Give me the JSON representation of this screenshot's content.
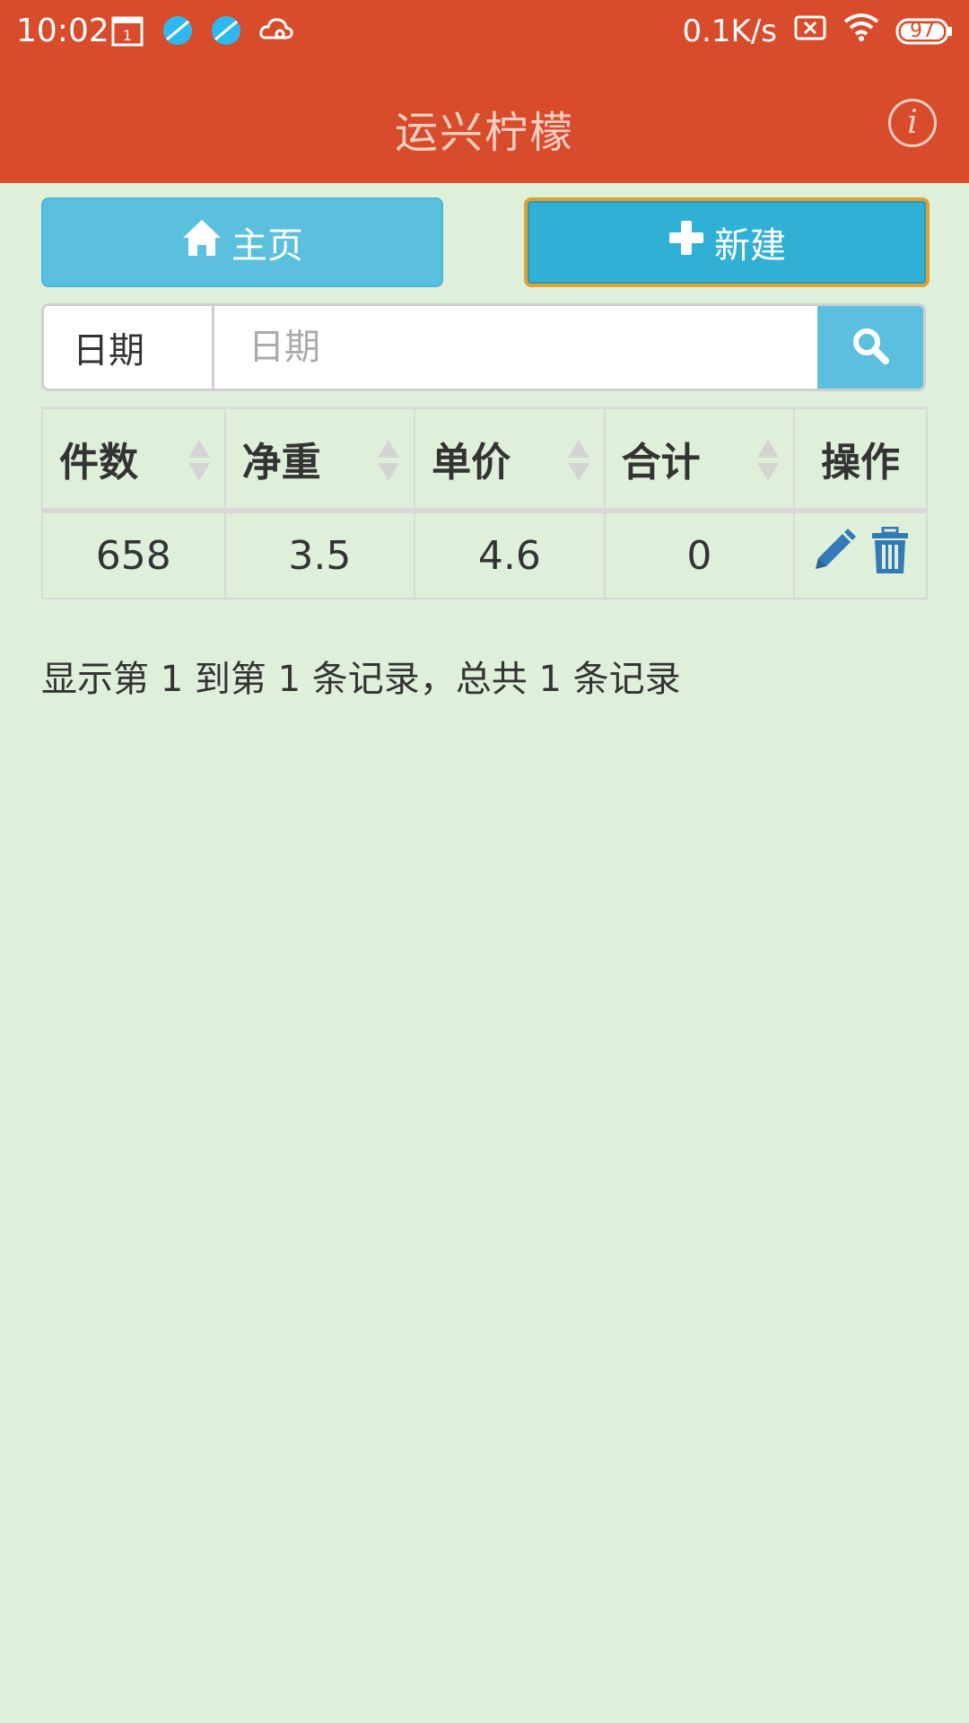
{
  "status": {
    "time": "10:02",
    "calendar_day": "1",
    "net_speed": "0.1K/s",
    "battery": "97"
  },
  "appbar": {
    "title": "运兴柠檬",
    "info_label": "i"
  },
  "buttons": {
    "home_label": "主页",
    "new_label": "新建"
  },
  "search": {
    "addon_label": "日期",
    "placeholder": "日期",
    "value": ""
  },
  "table": {
    "headers": [
      "件数",
      "净重",
      "单价",
      "合计",
      "操作"
    ],
    "rows": [
      {
        "count": "658",
        "net_weight": "3.5",
        "unit_price": "4.6",
        "total": "0"
      }
    ]
  },
  "pagination": {
    "summary": "显示第 1 到第 1 条记录，总共 1 条记录"
  },
  "colors": {
    "header": "#d84b2b",
    "background": "#dff0da",
    "info_button": "#5bc0de",
    "primary_button": "#31b0d5",
    "action_icon": "#337ab7"
  },
  "icons": [
    "calendar-icon",
    "app-notification-icon",
    "cloud-icon",
    "sim-icon",
    "wifi-icon",
    "battery-icon",
    "info-icon",
    "home-icon",
    "plus-icon",
    "search-icon",
    "edit-icon",
    "trash-icon"
  ]
}
